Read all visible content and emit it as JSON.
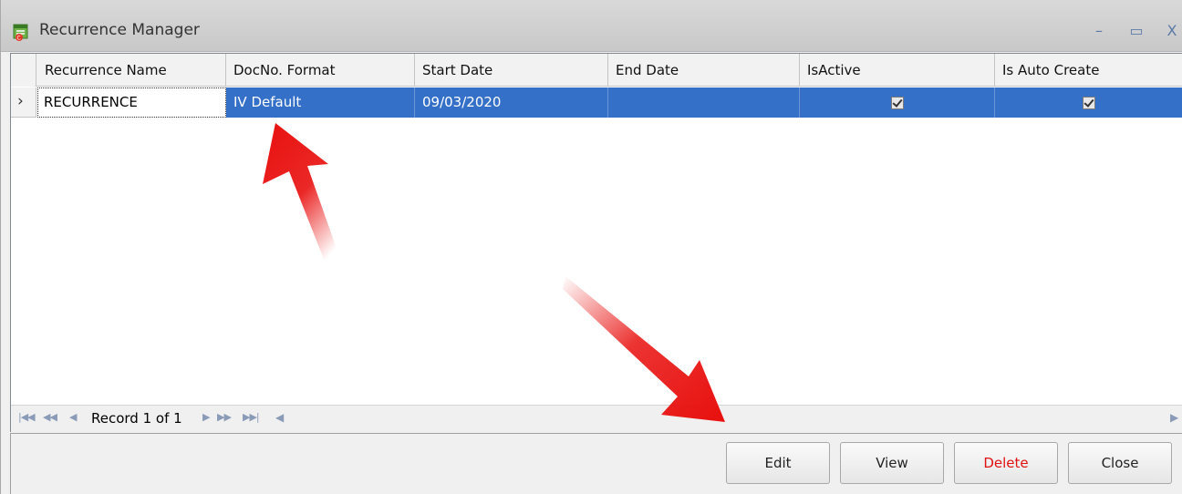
{
  "window": {
    "title": "Recurrence Manager",
    "minimize_glyph": "–",
    "maximize_glyph": "▭",
    "close_glyph": "X",
    "icon": "recurrence-manager-icon"
  },
  "grid": {
    "columns": [
      "Recurrence Name",
      "DocNo. Format",
      "Start Date",
      "End Date",
      "IsActive",
      "Is Auto Create"
    ],
    "rows": [
      {
        "recurrence_name": "RECURRENCE",
        "docno_format": "IV Default",
        "start_date": "09/03/2020",
        "end_date": "",
        "is_active": true,
        "is_auto_create": true,
        "selected": true
      }
    ],
    "row_indicator": "›"
  },
  "navigator": {
    "record_text": "Record 1 of 1",
    "first_glyph": "⏮",
    "prev_page_glyph": "◀◀",
    "prev_glyph": "◀",
    "next_glyph": "▶",
    "next_page_glyph": "▶▶",
    "last_glyph": "⏭"
  },
  "buttons": {
    "edit": "Edit",
    "view": "View",
    "delete": "Delete",
    "close": "Close"
  },
  "colors": {
    "selection": "#3570c8",
    "delete_text": "#e01010",
    "annotation_arrow": "#e8100e"
  }
}
